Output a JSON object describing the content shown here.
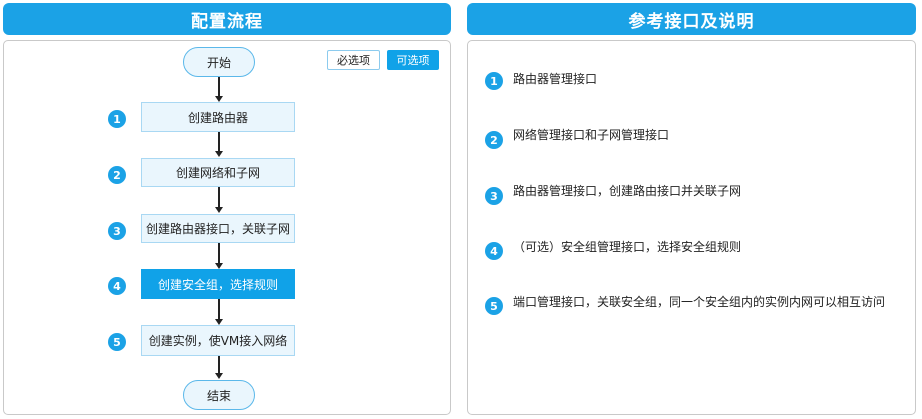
{
  "left": {
    "title": "配置流程",
    "legend": {
      "required": "必选项",
      "optional": "可选项"
    },
    "start": "开始",
    "end": "结束",
    "steps": [
      {
        "num": "1",
        "label": "创建路由器"
      },
      {
        "num": "2",
        "label": "创建网络和子网"
      },
      {
        "num": "3",
        "label": "创建路由器接口，关联子网"
      },
      {
        "num": "4",
        "label": "创建安全组，选择规则"
      },
      {
        "num": "5",
        "label": "创建实例，使VM接入网络"
      }
    ]
  },
  "right": {
    "title": "参考接口及说明",
    "items": [
      {
        "num": "1",
        "text": "路由器管理接口"
      },
      {
        "num": "2",
        "text": "网络管理接口和子网管理接口"
      },
      {
        "num": "3",
        "text": "路由器管理接口，创建路由接口并关联子网"
      },
      {
        "num": "4",
        "text": "（可选）安全组管理接口，选择安全组规则"
      },
      {
        "num": "5",
        "text": "端口管理接口，关联安全组，同一个安全组内的实例内网可以相互访问"
      }
    ]
  },
  "colors": {
    "accent": "#1ba2e6",
    "active_step": "#10a2e8",
    "node_fill": "#eaf6fd"
  }
}
